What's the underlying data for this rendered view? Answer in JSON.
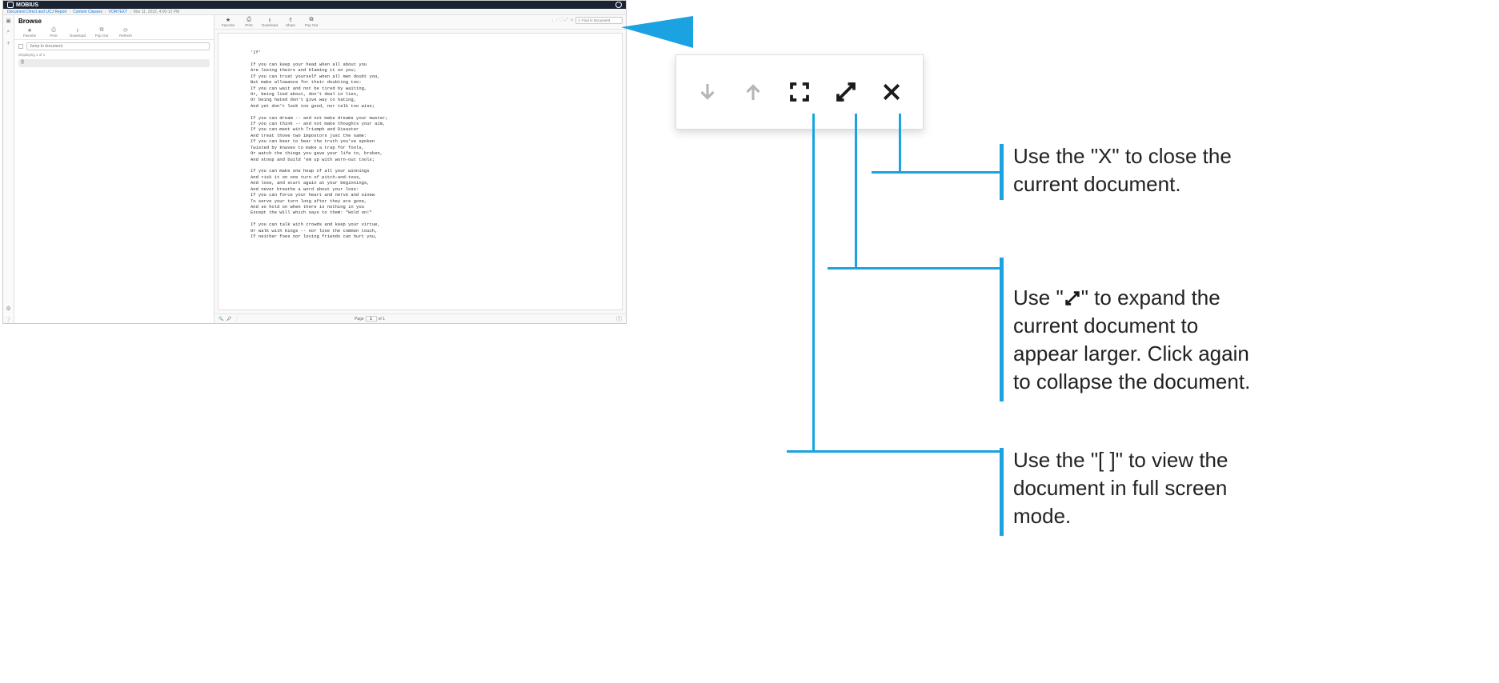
{
  "app": {
    "title": "MOBIUS",
    "breadcrumb": {
      "a": "Document Direct and UCJ Report",
      "b": "Content Classes",
      "c": "VORTEXT",
      "ts": "Mar 11, 2022, 4:00:12 PM"
    }
  },
  "vstrip": {
    "i1": "folder-icon",
    "i2": "search-icon",
    "i3": "plus-icon",
    "i4": "gear-icon",
    "i5": "help-icon"
  },
  "browse": {
    "title": "Browse",
    "tools": {
      "favorite": {
        "label": "Favorite"
      },
      "print": {
        "label": "Print"
      },
      "download": {
        "label": "Download"
      },
      "popout": {
        "label": "Pop Out"
      },
      "refresh": {
        "label": "Refresh"
      }
    },
    "jump_placeholder": "Jump to document",
    "displaying": "Displaying 1 of 1",
    "items": [
      {
        "label": " "
      }
    ]
  },
  "viewer": {
    "tools": {
      "favorite": {
        "label": "Favorite"
      },
      "print": {
        "label": "Print"
      },
      "download": {
        "label": "Download"
      },
      "share": {
        "label": "Share"
      },
      "popout": {
        "label": "Pop Out"
      }
    },
    "topicons": {
      "down": "down-arrow-icon",
      "up": "up-arrow-icon",
      "fullscreen": "fullscreen-icon",
      "expand": "expand-icon",
      "close": "close-icon"
    },
    "find_placeholder": "Find in Document",
    "doc_text": "'If'\n\nIf you can keep your head when all about you\nAre losing theirs and blaming it on you;\nIf you can trust yourself when all men doubt you,\nBut make allowance for their doubting too:\nIf you can wait and not be tired by waiting,\nOr, being lied about, don't deal in lies,\nOr being hated don't give way to hating,\nAnd yet don't look too good, nor talk too wise;\n\nIf you can dream -- and not make dreams your master;\nIf you can think -- and not make thoughts your aim,\nIf you can meet with Triumph and Disaster\nAnd treat those two impostors just the same:\nIf you can bear to hear the truth you've spoken\nTwisted by knaves to make a trap for fools,\nOr watch the things you gave your life to, broken,\nAnd stoop and build 'em up with worn-out tools;\n\nIf you can make one heap of all your winnings\nAnd risk it on one turn of pitch-and-toss,\nAnd lose, and start again at your beginnings,\nAnd never breathe a word about your loss:\nIf you can force your heart and nerve and sinew\nTo serve your turn long after they are gone,\nAnd so hold on when there is nothing in you\nExcept the Will which says to them: \"Hold on!\"\n\nIf you can talk with crowds and keep your virtue,\nOr walk with Kings -- nor lose the common touch,\nIf neither foes nor loving friends can hurt you,",
    "footer": {
      "page_label": "Page",
      "page_value": "1",
      "of_label": "of  1"
    }
  },
  "annotations": {
    "close": "Use the \"X\" to close the current document.",
    "expand": "Use \"      \" to expand the current document to appear larger. Click again to collapse the document.",
    "fullscreen": "Use the \"[ ]\" to view the document in full screen mode."
  }
}
